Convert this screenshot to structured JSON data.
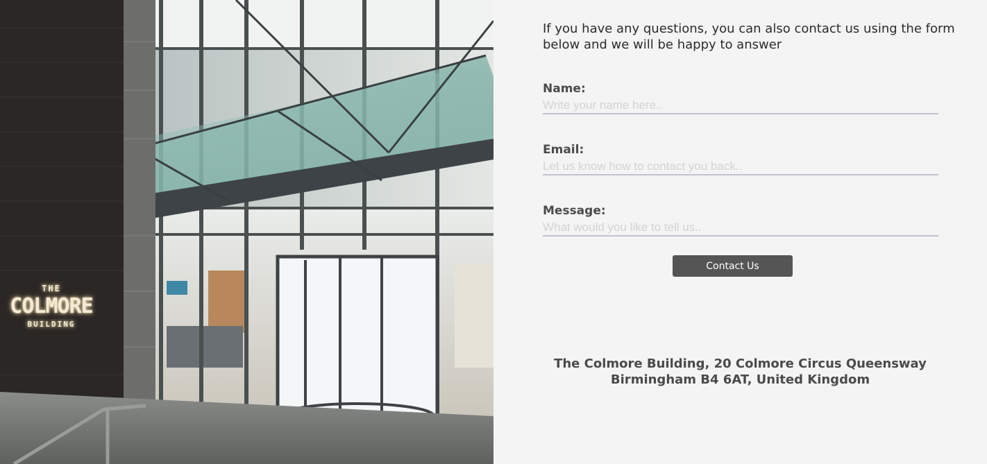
{
  "hero_image": {
    "sign": {
      "line1": "THE",
      "line2": "COLMORE",
      "line3": "BUILDING"
    }
  },
  "contact": {
    "intro": "If you have any questions, you can also contact us using the form below and we will be happy to answer",
    "name": {
      "label": "Name:",
      "placeholder": "Write your name here.."
    },
    "email": {
      "label": "Email:",
      "placeholder": "Let us know how to contact you back.."
    },
    "message": {
      "label": "Message:",
      "placeholder": "What would you like to tell us.."
    },
    "submit_label": "Contact Us"
  },
  "address": {
    "line1": "The Colmore Building, 20 Colmore Circus Queensway",
    "line2": "Birmingham B4 6AT, United Kingdom"
  },
  "colors": {
    "panel_background": "#f4f4f4",
    "button_background": "#555555",
    "input_underline": "#c3c3cf"
  }
}
